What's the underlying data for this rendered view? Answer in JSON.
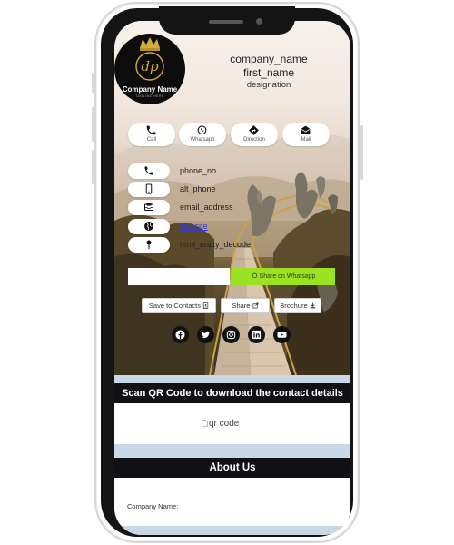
{
  "header": {
    "company_name": "company_name",
    "first_name": "first_name",
    "designation": "designation",
    "logo_text": "Company Name",
    "logo_tagline": "TAGLINE HERE",
    "logo_monogram": "dp"
  },
  "quick_actions": [
    {
      "label": "Call",
      "icon": "phone-icon"
    },
    {
      "label": "Whatsapp",
      "icon": "whatsapp-icon"
    },
    {
      "label": "Direction",
      "icon": "direction-icon"
    },
    {
      "label": "Mail",
      "icon": "mail-icon"
    }
  ],
  "contacts": [
    {
      "value": "phone_no",
      "icon": "phone-icon"
    },
    {
      "value": "alt_phone",
      "icon": "mobile-icon"
    },
    {
      "value": "email_address",
      "icon": "envelope-icon"
    },
    {
      "value": "website",
      "icon": "globe-icon"
    },
    {
      "value": "html_entity_decode",
      "icon": "map-pin-icon"
    }
  ],
  "whatsapp_share": {
    "input_value": "",
    "button_label": "Share on Whatsapp"
  },
  "actions": {
    "save_contacts": "Save to Contacts",
    "share": "Share",
    "brochure": "Brochure"
  },
  "social": [
    "facebook-icon",
    "twitter-icon",
    "instagram-icon",
    "linkedin-icon",
    "youtube-icon"
  ],
  "qr_section": {
    "title": "Scan QR Code to download the contact details",
    "image_alt": "qr code"
  },
  "about": {
    "title": "About Us",
    "company_name_label": "Company Name:"
  },
  "colors": {
    "accent_green": "#9be320",
    "dark_bar": "#111014",
    "band": "#c9d8e6",
    "link": "#2f3bd9"
  }
}
